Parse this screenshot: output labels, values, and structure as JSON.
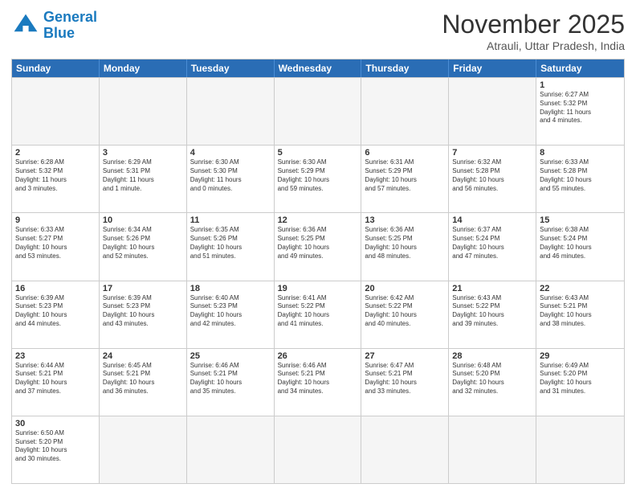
{
  "header": {
    "logo_general": "General",
    "logo_blue": "Blue",
    "month_title": "November 2025",
    "location": "Atrauli, Uttar Pradesh, India"
  },
  "days_of_week": [
    "Sunday",
    "Monday",
    "Tuesday",
    "Wednesday",
    "Thursday",
    "Friday",
    "Saturday"
  ],
  "weeks": [
    [
      {
        "day": "",
        "info": ""
      },
      {
        "day": "",
        "info": ""
      },
      {
        "day": "",
        "info": ""
      },
      {
        "day": "",
        "info": ""
      },
      {
        "day": "",
        "info": ""
      },
      {
        "day": "",
        "info": ""
      },
      {
        "day": "1",
        "info": "Sunrise: 6:27 AM\nSunset: 5:32 PM\nDaylight: 11 hours\nand 4 minutes."
      }
    ],
    [
      {
        "day": "2",
        "info": "Sunrise: 6:28 AM\nSunset: 5:32 PM\nDaylight: 11 hours\nand 3 minutes."
      },
      {
        "day": "3",
        "info": "Sunrise: 6:29 AM\nSunset: 5:31 PM\nDaylight: 11 hours\nand 1 minute."
      },
      {
        "day": "4",
        "info": "Sunrise: 6:30 AM\nSunset: 5:30 PM\nDaylight: 11 hours\nand 0 minutes."
      },
      {
        "day": "5",
        "info": "Sunrise: 6:30 AM\nSunset: 5:29 PM\nDaylight: 10 hours\nand 59 minutes."
      },
      {
        "day": "6",
        "info": "Sunrise: 6:31 AM\nSunset: 5:29 PM\nDaylight: 10 hours\nand 57 minutes."
      },
      {
        "day": "7",
        "info": "Sunrise: 6:32 AM\nSunset: 5:28 PM\nDaylight: 10 hours\nand 56 minutes."
      },
      {
        "day": "8",
        "info": "Sunrise: 6:33 AM\nSunset: 5:28 PM\nDaylight: 10 hours\nand 55 minutes."
      }
    ],
    [
      {
        "day": "9",
        "info": "Sunrise: 6:33 AM\nSunset: 5:27 PM\nDaylight: 10 hours\nand 53 minutes."
      },
      {
        "day": "10",
        "info": "Sunrise: 6:34 AM\nSunset: 5:26 PM\nDaylight: 10 hours\nand 52 minutes."
      },
      {
        "day": "11",
        "info": "Sunrise: 6:35 AM\nSunset: 5:26 PM\nDaylight: 10 hours\nand 51 minutes."
      },
      {
        "day": "12",
        "info": "Sunrise: 6:36 AM\nSunset: 5:25 PM\nDaylight: 10 hours\nand 49 minutes."
      },
      {
        "day": "13",
        "info": "Sunrise: 6:36 AM\nSunset: 5:25 PM\nDaylight: 10 hours\nand 48 minutes."
      },
      {
        "day": "14",
        "info": "Sunrise: 6:37 AM\nSunset: 5:24 PM\nDaylight: 10 hours\nand 47 minutes."
      },
      {
        "day": "15",
        "info": "Sunrise: 6:38 AM\nSunset: 5:24 PM\nDaylight: 10 hours\nand 46 minutes."
      }
    ],
    [
      {
        "day": "16",
        "info": "Sunrise: 6:39 AM\nSunset: 5:23 PM\nDaylight: 10 hours\nand 44 minutes."
      },
      {
        "day": "17",
        "info": "Sunrise: 6:39 AM\nSunset: 5:23 PM\nDaylight: 10 hours\nand 43 minutes."
      },
      {
        "day": "18",
        "info": "Sunrise: 6:40 AM\nSunset: 5:23 PM\nDaylight: 10 hours\nand 42 minutes."
      },
      {
        "day": "19",
        "info": "Sunrise: 6:41 AM\nSunset: 5:22 PM\nDaylight: 10 hours\nand 41 minutes."
      },
      {
        "day": "20",
        "info": "Sunrise: 6:42 AM\nSunset: 5:22 PM\nDaylight: 10 hours\nand 40 minutes."
      },
      {
        "day": "21",
        "info": "Sunrise: 6:43 AM\nSunset: 5:22 PM\nDaylight: 10 hours\nand 39 minutes."
      },
      {
        "day": "22",
        "info": "Sunrise: 6:43 AM\nSunset: 5:21 PM\nDaylight: 10 hours\nand 38 minutes."
      }
    ],
    [
      {
        "day": "23",
        "info": "Sunrise: 6:44 AM\nSunset: 5:21 PM\nDaylight: 10 hours\nand 37 minutes."
      },
      {
        "day": "24",
        "info": "Sunrise: 6:45 AM\nSunset: 5:21 PM\nDaylight: 10 hours\nand 36 minutes."
      },
      {
        "day": "25",
        "info": "Sunrise: 6:46 AM\nSunset: 5:21 PM\nDaylight: 10 hours\nand 35 minutes."
      },
      {
        "day": "26",
        "info": "Sunrise: 6:46 AM\nSunset: 5:21 PM\nDaylight: 10 hours\nand 34 minutes."
      },
      {
        "day": "27",
        "info": "Sunrise: 6:47 AM\nSunset: 5:21 PM\nDaylight: 10 hours\nand 33 minutes."
      },
      {
        "day": "28",
        "info": "Sunrise: 6:48 AM\nSunset: 5:20 PM\nDaylight: 10 hours\nand 32 minutes."
      },
      {
        "day": "29",
        "info": "Sunrise: 6:49 AM\nSunset: 5:20 PM\nDaylight: 10 hours\nand 31 minutes."
      }
    ],
    [
      {
        "day": "30",
        "info": "Sunrise: 6:50 AM\nSunset: 5:20 PM\nDaylight: 10 hours\nand 30 minutes."
      },
      {
        "day": "",
        "info": ""
      },
      {
        "day": "",
        "info": ""
      },
      {
        "day": "",
        "info": ""
      },
      {
        "day": "",
        "info": ""
      },
      {
        "day": "",
        "info": ""
      },
      {
        "day": "",
        "info": ""
      }
    ]
  ]
}
